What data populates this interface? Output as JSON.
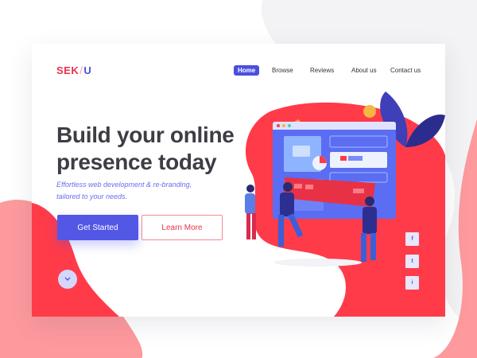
{
  "logo": {
    "part1": "SEK",
    "separator": "/",
    "part2": "U"
  },
  "nav": {
    "items": [
      {
        "label": "Home",
        "active": true
      },
      {
        "label": "Browse",
        "active": false
      },
      {
        "label": "Reviews",
        "active": false
      },
      {
        "label": "About us",
        "active": false
      },
      {
        "label": "Contact us",
        "active": false
      }
    ]
  },
  "hero": {
    "headline_line1": "Build your online",
    "headline_line2": "presence today",
    "subtitle_line1": "Effortless web development & re-branding,",
    "subtitle_line2": "tailored to your needs."
  },
  "buttons": {
    "primary": "Get Started",
    "secondary": "Learn More"
  },
  "social": {
    "facebook": "f",
    "twitter": "t",
    "info": "i"
  },
  "icons": {
    "scroll": "chevron-down-icon",
    "facebook": "facebook-icon",
    "twitter": "twitter-icon",
    "info": "info-icon"
  },
  "colors": {
    "brand_red": "#ff3b4a",
    "brand_indigo": "#5357e6",
    "pink": "#fd9a9e",
    "headline": "#3d3d45"
  }
}
